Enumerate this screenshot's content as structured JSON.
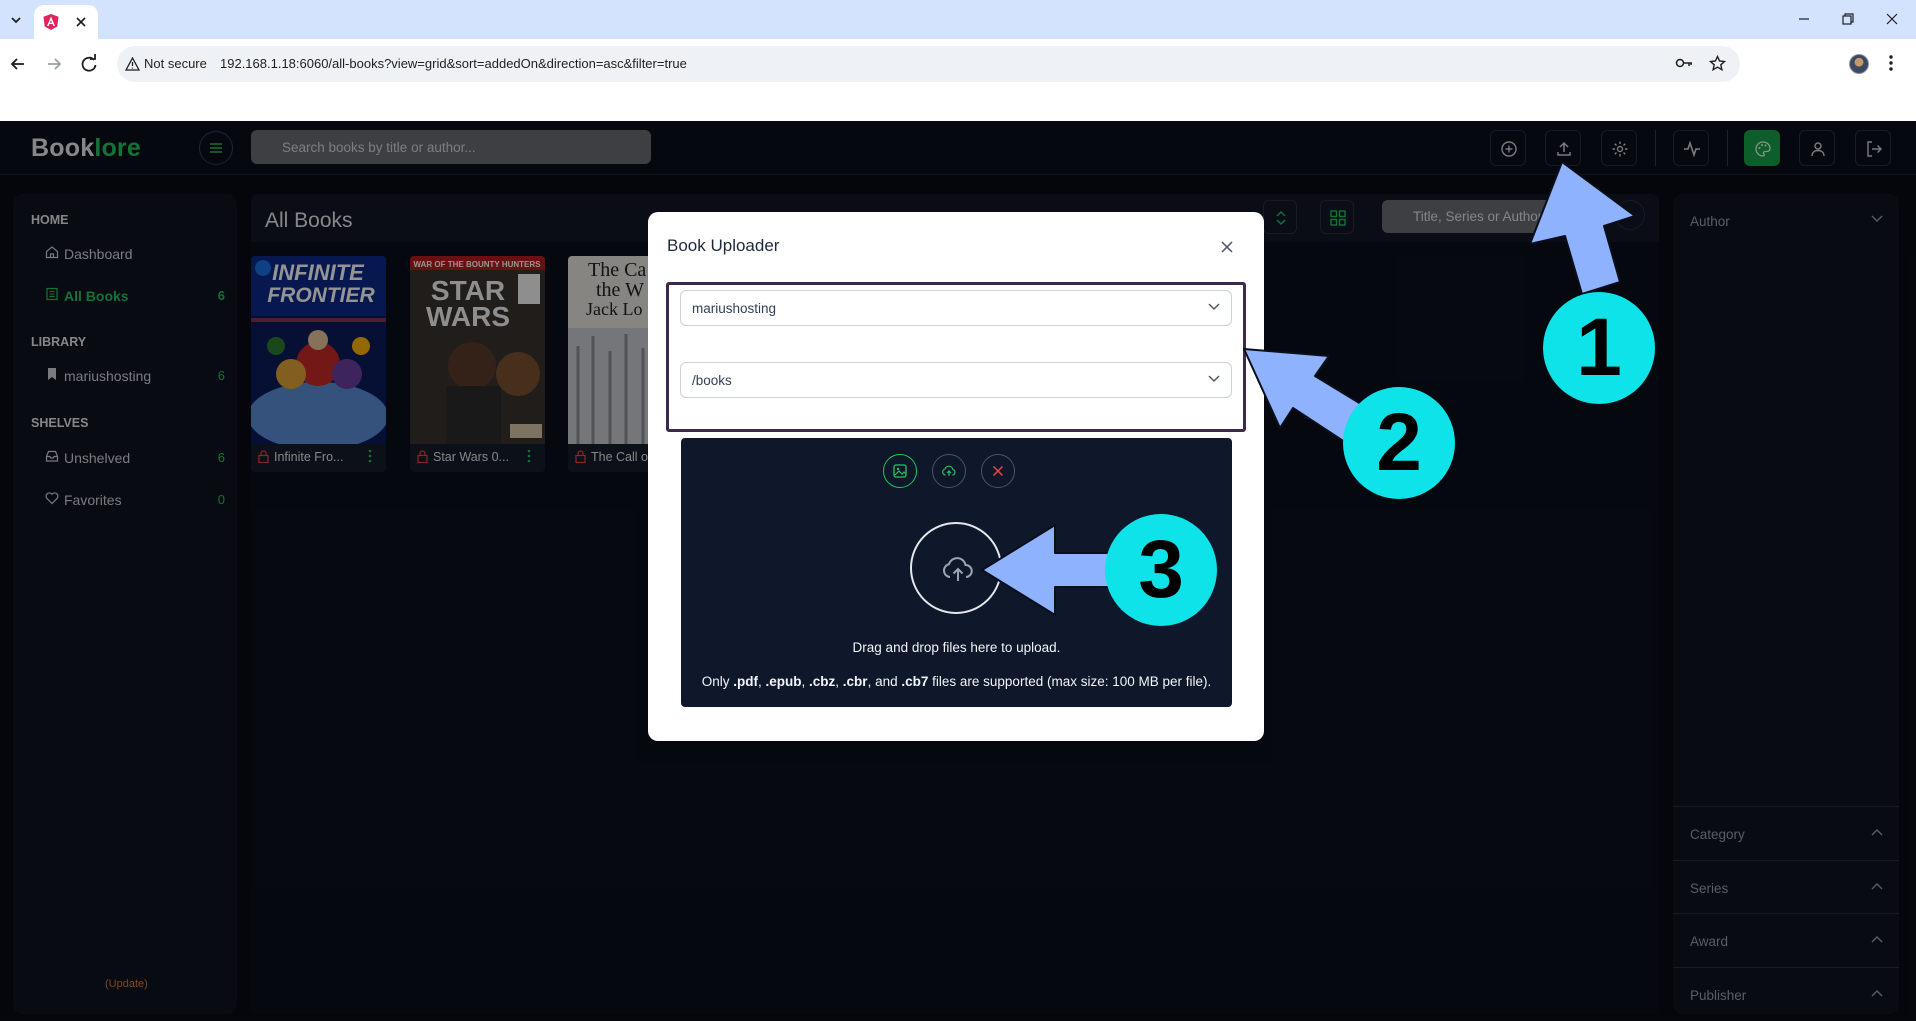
{
  "browser": {
    "url": "192.168.1.18:6060/all-books?view=grid&sort=addedOn&direction=asc&filter=true",
    "security_label": "Not secure"
  },
  "app": {
    "logo_book": "Book",
    "logo_lore": "lore",
    "search_placeholder": "Search books by title or author..."
  },
  "sidebar": {
    "sections": [
      {
        "title": "HOME",
        "items": [
          {
            "label": "Dashboard",
            "count": "",
            "icon": "home-icon"
          },
          {
            "label": "All Books",
            "count": "6",
            "icon": "book-icon",
            "active": true
          }
        ]
      },
      {
        "title": "LIBRARY",
        "items": [
          {
            "label": "mariushosting",
            "count": "6",
            "icon": "bookmark-icon"
          }
        ]
      },
      {
        "title": "SHELVES",
        "items": [
          {
            "label": "Unshelved",
            "count": "6",
            "icon": "inbox-icon"
          },
          {
            "label": "Favorites",
            "count": "0",
            "icon": "heart-icon"
          }
        ]
      }
    ],
    "update_label": "(Update)"
  },
  "main": {
    "title": "All Books",
    "filter_placeholder": "Title, Series or Author",
    "books": [
      {
        "title": "Infinite Fro..."
      },
      {
        "title": "Star Wars 0..."
      },
      {
        "title": "The Call o"
      }
    ]
  },
  "filters": {
    "top": "Author",
    "sections": [
      "Category",
      "Series",
      "Award",
      "Publisher"
    ]
  },
  "dialog": {
    "title": "Book Uploader",
    "library_value": "mariushosting",
    "path_value": "/books",
    "drop_text": "Drag and drop files here to upload.",
    "formats_prefix": "Only ",
    "formats": [
      ".pdf",
      ".epub",
      ".cbz",
      ".cbr",
      ".cb7"
    ],
    "formats_and": "and",
    "formats_suffix": " files are supported (max size: 100 MB per file)."
  },
  "annotations": [
    "1",
    "2",
    "3"
  ],
  "colors": {
    "accent": "#22c55e",
    "annotation_badge": "#0de3e8",
    "annotation_arrow": "#8fb2ff"
  }
}
